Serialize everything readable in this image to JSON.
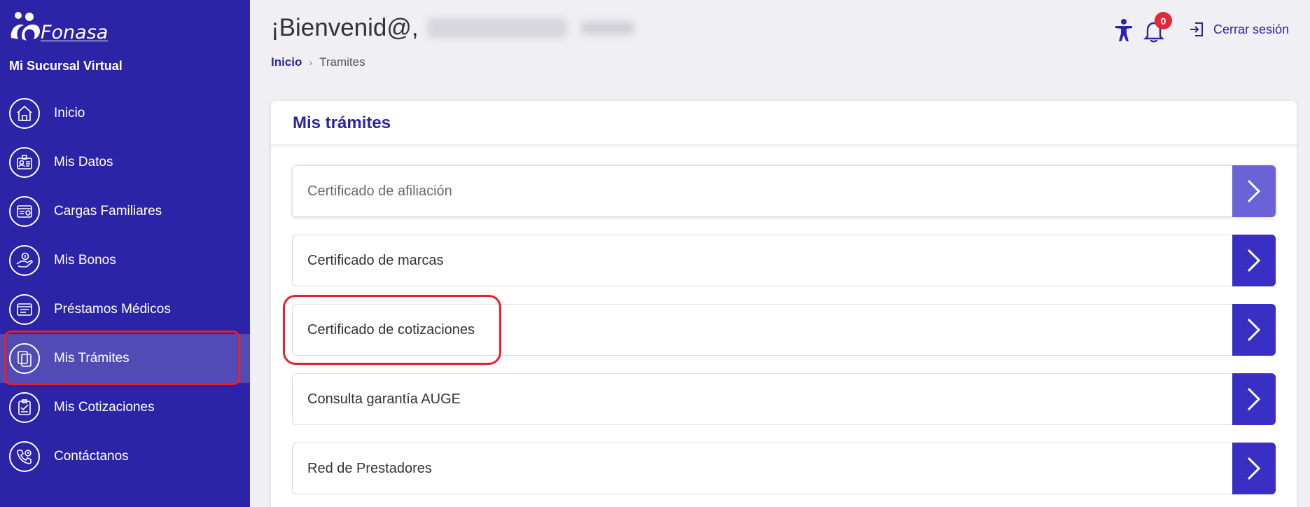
{
  "brand": {
    "logo_text": "Fonasa",
    "subtitle": "Mi Sucursal Virtual"
  },
  "sidebar": {
    "items": [
      {
        "label": "Inicio",
        "icon": "home-icon"
      },
      {
        "label": "Mis Datos",
        "icon": "id-card-icon"
      },
      {
        "label": "Cargas Familiares",
        "icon": "family-card-icon"
      },
      {
        "label": "Mis Bonos",
        "icon": "hand-coin-icon"
      },
      {
        "label": "Préstamos Médicos",
        "icon": "document-icon"
      },
      {
        "label": "Mis Trámites",
        "icon": "files-icon",
        "active": true
      },
      {
        "label": "Mis Cotizaciones",
        "icon": "clipboard-icon"
      },
      {
        "label": "Contáctanos",
        "icon": "phone-icon"
      }
    ]
  },
  "header": {
    "welcome": "¡Bienvenid@,",
    "breadcrumb": {
      "home": "Inicio",
      "current": "Tramites"
    },
    "notifications_count": "0",
    "logout_label": "Cerrar sesión"
  },
  "main": {
    "title": "Mis trámites",
    "items": [
      "Certificado de afiliación",
      "Certificado de marcas",
      "Certificado de cotizaciones",
      "Consulta garantía AUGE",
      "Red de Prestadores"
    ]
  },
  "colors": {
    "primary": "#2c24a6",
    "button": "#3a2fc4",
    "highlight": "#e8202a",
    "badge": "#e0283a"
  }
}
